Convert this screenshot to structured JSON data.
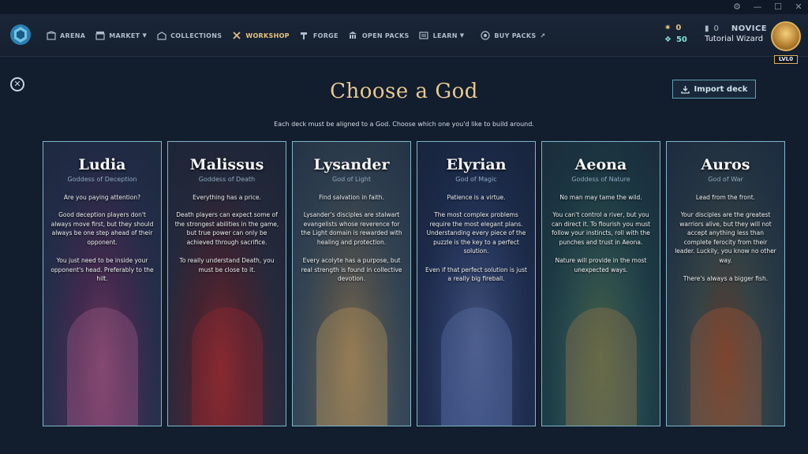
{
  "window": {
    "buttons": [
      "⚙",
      "—",
      "☐",
      "✕"
    ]
  },
  "nav": {
    "items": [
      {
        "label": "ARENA",
        "icon": "arena-icon",
        "caret": false
      },
      {
        "label": "MARKET",
        "icon": "market-icon",
        "caret": true
      },
      {
        "label": "COLLECTIONS",
        "icon": "collections-icon",
        "caret": false
      },
      {
        "label": "WORKSHOP",
        "icon": "workshop-icon",
        "caret": false,
        "active": true
      },
      {
        "label": "FORGE",
        "icon": "forge-icon",
        "caret": false
      },
      {
        "label": "OPEN PACKS",
        "icon": "open-packs-icon",
        "caret": false
      },
      {
        "label": "LEARN",
        "icon": "learn-icon",
        "caret": true
      },
      {
        "label": "BUY PACKS",
        "icon": "buy-packs-icon",
        "caret": false,
        "external": true
      }
    ],
    "currency": {
      "flux": "0",
      "gems": "50"
    },
    "rank": {
      "count": "0",
      "label": "NOVICE"
    },
    "username": "Tutorial Wizard",
    "level": "LVL0"
  },
  "page": {
    "title": "Choose a God",
    "subtitle": "Each deck must be aligned to a God. Choose which one you'd like to build around.",
    "import_label": "Import deck"
  },
  "gods": [
    {
      "name": "Ludia",
      "epithet": "Goddess of Deception",
      "tagline": "Are you paying attention?",
      "para1": "Good deception players don't always move first, but they should always be one step ahead of their opponent.",
      "para2": "You just need to be inside your opponent's head. Preferably to the hilt."
    },
    {
      "name": "Malissus",
      "epithet": "Goddess of Death",
      "tagline": "Everything has a price.",
      "para1": "Death players can expect some of the strongest abilities in the game, but true power can only be achieved through sacrifice.",
      "para2": "To really understand Death, you must be close to it."
    },
    {
      "name": "Lysander",
      "epithet": "God of Light",
      "tagline": "Find salvation in faith.",
      "para1": "Lysander's disciples are stalwart evangelists whose reverence for the Light domain is rewarded with healing and protection.",
      "para2": "Every acolyte has a purpose, but real strength is found in collective devotion."
    },
    {
      "name": "Elyrian",
      "epithet": "God of Magic",
      "tagline": "Patience is a virtue.",
      "para1": "The most complex problems require the most elegant plans. Understanding every piece of the puzzle is the key to a perfect solution.",
      "para2": "Even if that perfect solution is just a really big fireball."
    },
    {
      "name": "Aeona",
      "epithet": "Goddess of Nature",
      "tagline": "No man may tame the wild.",
      "para1": "You can't control a river, but you can direct it. To flourish you must follow your instincts, roll with the punches and trust in Aeona.",
      "para2": "Nature will provide in the most unexpected ways."
    },
    {
      "name": "Auros",
      "epithet": "God of War",
      "tagline": "Lead from the front.",
      "para1": "Your disciples are the greatest warriors alive, but they will not accept anything less than complete ferocity from their leader. Luckily, you know no other way.",
      "para2": "There's always a bigger fish."
    }
  ]
}
